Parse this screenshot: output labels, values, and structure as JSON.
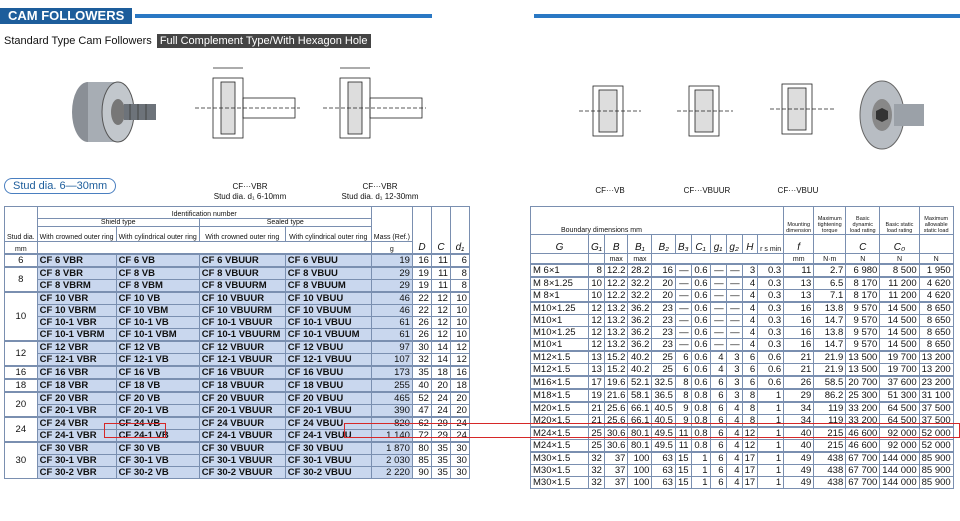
{
  "header": {
    "title": "CAM FOLLOWERS"
  },
  "subtitle": {
    "text": "Standard Type Cam Followers",
    "tag": "Full Complement Type/With Hexagon Hole"
  },
  "captions": {
    "c1a": "CF···VBR",
    "c1b": "Stud dia. d₁  6-10mm",
    "c2a": "CF···VBR",
    "c2b": "Stud dia. d₁  12-30mm",
    "c3": "CF···VB",
    "c4": "CF···VBUUR",
    "c5": "CF···VBUU"
  },
  "stud_range": "Stud dia. 6—30mm",
  "left_header": {
    "stud": "Stud dia.",
    "mm": "mm",
    "ident": "Identification number",
    "shield": "Shield type",
    "sealed": "Sealed type",
    "crowned": "With crowned outer ring",
    "cyl": "With cylindrical outer ring",
    "mass": "Mass (Ref.)",
    "g": "g",
    "D": "D",
    "C": "C",
    "d1": "d₁"
  },
  "right_header": {
    "boundary": "Boundary dimensions  mm",
    "mounting": "Mounting dimension",
    "maxtorque": "Maximum tightening torque",
    "dyn": "Basic dynamic load rating",
    "stat": "Basic static load rating",
    "allow": "Maximum allowable static load",
    "G": "G",
    "G1": "G₁",
    "B": "B",
    "B1": "B₁",
    "B2": "B₂",
    "B3": "B₃",
    "C1": "C₁",
    "g1": "g₁",
    "g2": "g₂",
    "H": "H",
    "r": "r s min",
    "f": "f",
    "min": "Min.",
    "mm": "mm",
    "Nm": "N·m",
    "Cr": "C",
    "C0": "C₀",
    "N": "N",
    "max": "max"
  },
  "groups": [
    {
      "stud": "6",
      "rows": [
        [
          "CF  6  VBR",
          "CF  6  VB",
          "CF  6  VBUUR",
          "CF  6  VBUU",
          "19",
          "16",
          "11",
          "6"
        ]
      ]
    },
    {
      "stud": "8",
      "rows": [
        [
          "CF  8  VBR",
          "CF  8  VB",
          "CF  8  VBUUR",
          "CF  8  VBUU",
          "29",
          "19",
          "11",
          "8"
        ],
        [
          "CF  8  VBRM",
          "CF  8  VBM",
          "CF  8  VBUURM",
          "CF  8  VBUUM",
          "29",
          "19",
          "11",
          "8"
        ]
      ]
    },
    {
      "stud": "10",
      "rows": [
        [
          "CF 10  VBR",
          "CF 10  VB",
          "CF 10  VBUUR",
          "CF 10  VBUU",
          "46",
          "22",
          "12",
          "10"
        ],
        [
          "CF 10  VBRM",
          "CF 10  VBM",
          "CF 10  VBUURM",
          "CF 10  VBUUM",
          "46",
          "22",
          "12",
          "10"
        ],
        [
          "CF 10-1 VBR",
          "CF 10-1 VB",
          "CF 10-1 VBUUR",
          "CF 10-1 VBUU",
          "61",
          "26",
          "12",
          "10"
        ],
        [
          "CF 10-1 VBRM",
          "CF 10-1 VBM",
          "CF 10-1 VBUURM",
          "CF 10-1 VBUUM",
          "61",
          "26",
          "12",
          "10"
        ]
      ]
    },
    {
      "stud": "12",
      "rows": [
        [
          "CF 12  VBR",
          "CF 12  VB",
          "CF 12  VBUUR",
          "CF 12  VBUU",
          "97",
          "30",
          "14",
          "12"
        ],
        [
          "CF 12-1 VBR",
          "CF 12-1 VB",
          "CF 12-1 VBUUR",
          "CF 12-1 VBUU",
          "107",
          "32",
          "14",
          "12"
        ]
      ]
    },
    {
      "stud": "16",
      "rows": [
        [
          "CF 16  VBR",
          "CF 16  VB",
          "CF 16  VBUUR",
          "CF 16  VBUU",
          "173",
          "35",
          "18",
          "16"
        ]
      ]
    },
    {
      "stud": "18",
      "rows": [
        [
          "CF 18  VBR",
          "CF 18  VB",
          "CF 18  VBUUR",
          "CF 18  VBUU",
          "255",
          "40",
          "20",
          "18"
        ]
      ]
    },
    {
      "stud": "20",
      "rows": [
        [
          "CF 20  VBR",
          "CF 20  VB",
          "CF 20  VBUUR",
          "CF 20  VBUU",
          "465",
          "52",
          "24",
          "20"
        ],
        [
          "CF 20-1 VBR",
          "CF 20-1 VB",
          "CF 20-1 VBUUR",
          "CF 20-1 VBUU",
          "390",
          "47",
          "24",
          "20"
        ]
      ]
    },
    {
      "stud": "24",
      "rows": [
        [
          "CF 24  VBR",
          "CF 24  VB",
          "CF 24  VBUUR",
          "CF 24  VBUU",
          "820",
          "62",
          "29",
          "24"
        ],
        [
          "CF 24-1 VBR",
          "CF 24-1 VB",
          "CF 24-1 VBUUR",
          "CF 24-1 VBUU",
          "1 140",
          "72",
          "29",
          "24"
        ]
      ]
    },
    {
      "stud": "30",
      "rows": [
        [
          "CF 30  VBR",
          "CF 30  VB",
          "CF 30  VBUUR",
          "CF 30  VBUU",
          "1 870",
          "80",
          "35",
          "30"
        ],
        [
          "CF 30-1 VBR",
          "CF 30-1 VB",
          "CF 30-1 VBUUR",
          "CF 30-1 VBUU",
          "2 030",
          "85",
          "35",
          "30"
        ],
        [
          "CF 30-2 VBR",
          "CF 30-2 VB",
          "CF 30-2 VBUUR",
          "CF 30-2 VBUU",
          "2 220",
          "90",
          "35",
          "30"
        ]
      ]
    }
  ],
  "right_groups": [
    [
      [
        "M  6×1",
        "8",
        "12.2",
        "28.2",
        "16",
        "—",
        "0.6",
        "—",
        "—",
        "3",
        "0.3",
        "11",
        "2.7",
        "6 980",
        "8 500",
        "1 950"
      ]
    ],
    [
      [
        "M  8×1.25",
        "10",
        "12.2",
        "32.2",
        "20",
        "—",
        "0.6",
        "—",
        "—",
        "4",
        "0.3",
        "13",
        "6.5",
        "8 170",
        "11 200",
        "4 620"
      ],
      [
        "M  8×1",
        "10",
        "12.2",
        "32.2",
        "20",
        "—",
        "0.6",
        "—",
        "—",
        "4",
        "0.3",
        "13",
        "7.1",
        "8 170",
        "11 200",
        "4 620"
      ]
    ],
    [
      [
        "M10×1.25",
        "12",
        "13.2",
        "36.2",
        "23",
        "—",
        "0.6",
        "—",
        "—",
        "4",
        "0.3",
        "16",
        "13.8",
        "9 570",
        "14 500",
        "8 650"
      ],
      [
        "M10×1",
        "12",
        "13.2",
        "36.2",
        "23",
        "—",
        "0.6",
        "—",
        "—",
        "4",
        "0.3",
        "16",
        "14.7",
        "9 570",
        "14 500",
        "8 650"
      ],
      [
        "M10×1.25",
        "12",
        "13.2",
        "36.2",
        "23",
        "—",
        "0.6",
        "—",
        "—",
        "4",
        "0.3",
        "16",
        "13.8",
        "9 570",
        "14 500",
        "8 650"
      ],
      [
        "M10×1",
        "12",
        "13.2",
        "36.2",
        "23",
        "—",
        "0.6",
        "—",
        "—",
        "4",
        "0.3",
        "16",
        "14.7",
        "9 570",
        "14 500",
        "8 650"
      ]
    ],
    [
      [
        "M12×1.5",
        "13",
        "15.2",
        "40.2",
        "25",
        "6",
        "0.6",
        "4",
        "3",
        "6",
        "0.6",
        "21",
        "21.9",
        "13 500",
        "19 700",
        "13 200"
      ],
      [
        "M12×1.5",
        "13",
        "15.2",
        "40.2",
        "25",
        "6",
        "0.6",
        "4",
        "3",
        "6",
        "0.6",
        "21",
        "21.9",
        "13 500",
        "19 700",
        "13 200"
      ]
    ],
    [
      [
        "M16×1.5",
        "17",
        "19.6",
        "52.1",
        "32.5",
        "8",
        "0.6",
        "6",
        "3",
        "6",
        "0.6",
        "26",
        "58.5",
        "20 700",
        "37 600",
        "23 200"
      ]
    ],
    [
      [
        "M18×1.5",
        "19",
        "21.6",
        "58.1",
        "36.5",
        "8",
        "0.8",
        "6",
        "3",
        "8",
        "1",
        "29",
        "86.2",
        "25 300",
        "51 300",
        "31 100"
      ]
    ],
    [
      [
        "M20×1.5",
        "21",
        "25.6",
        "66.1",
        "40.5",
        "9",
        "0.8",
        "6",
        "4",
        "8",
        "1",
        "34",
        "119",
        "33 200",
        "64 500",
        "37 500"
      ],
      [
        "M20×1.5",
        "21",
        "25.6",
        "66.1",
        "40.5",
        "9",
        "0.8",
        "6",
        "4",
        "8",
        "1",
        "34",
        "119",
        "33 200",
        "64 500",
        "37 500"
      ]
    ],
    [
      [
        "M24×1.5",
        "25",
        "30.6",
        "80.1",
        "49.5",
        "11",
        "0.8",
        "6",
        "4",
        "12",
        "1",
        "40",
        "215",
        "46 600",
        "92 000",
        "52 000"
      ],
      [
        "M24×1.5",
        "25",
        "30.6",
        "80.1",
        "49.5",
        "11",
        "0.8",
        "6",
        "4",
        "12",
        "1",
        "40",
        "215",
        "46 600",
        "92 000",
        "52 000"
      ]
    ],
    [
      [
        "M30×1.5",
        "32",
        "37",
        "100",
        "63",
        "15",
        "1",
        "6",
        "4",
        "17",
        "1",
        "49",
        "438",
        "67 700",
        "144 000",
        "85 900"
      ],
      [
        "M30×1.5",
        "32",
        "37",
        "100",
        "63",
        "15",
        "1",
        "6",
        "4",
        "17",
        "1",
        "49",
        "438",
        "67 700",
        "144 000",
        "85 900"
      ],
      [
        "M30×1.5",
        "32",
        "37",
        "100",
        "63",
        "15",
        "1",
        "6",
        "4",
        "17",
        "1",
        "49",
        "438",
        "67 700",
        "144 000",
        "85 900"
      ]
    ]
  ]
}
